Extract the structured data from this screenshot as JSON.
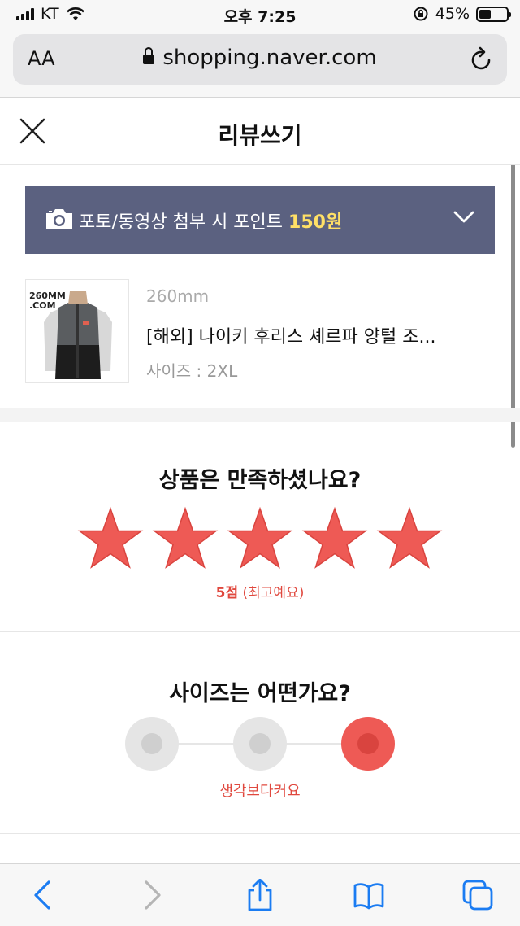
{
  "status_bar": {
    "carrier": "KT",
    "time": "오후 7:25",
    "battery": "45%"
  },
  "browser": {
    "text_size_label": "AA",
    "url": "shopping.naver.com"
  },
  "header": {
    "title": "리뷰쓰기"
  },
  "photo_banner": {
    "text": "포토/동영상 첨부 시 포인트 ",
    "points": "150원"
  },
  "product": {
    "thumb_watermark": "260MM .COM",
    "option": "260mm",
    "name": "[해외] 나이키 후리스 셰르파 양털 조...",
    "size": "사이즈 : 2XL"
  },
  "rating": {
    "question": "상품은 만족하셨나요?",
    "stars_selected": 5,
    "stars_total": 5,
    "score_label": "5점",
    "score_desc": " (최고예요)"
  },
  "size_feedback": {
    "question": "사이즈는 어떤가요?",
    "selected_index": 2,
    "selected_label": "생각보다커요"
  },
  "colors": {
    "accent_red": "#ee5a55",
    "banner_bg": "#5b6180",
    "points_yellow": "#ffe066",
    "ios_blue": "#1b7cf2"
  },
  "toolbar": {
    "icons": [
      "back-icon",
      "forward-icon",
      "share-icon",
      "bookmarks-icon",
      "tabs-icon"
    ]
  }
}
